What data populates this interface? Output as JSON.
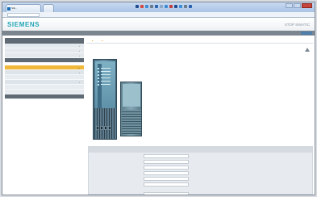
{
  "browser": {
    "tabs": [
      {
        "label": "SIE...",
        "active": true
      },
      {
        "label": ""
      }
    ],
    "address": "",
    "icon_colors": [
      "#1e4c8c",
      "#d6453b",
      "#3b8bd6",
      "#6a7a8a",
      "#2a62b0",
      "#8aa6c4",
      "#3b8bd6",
      "#c23b3b",
      "#1e4c8c",
      "#3b8bd6",
      "#6a7a8a",
      "#2a62b0"
    ]
  },
  "app": {
    "brand": "SIEMENS",
    "title": "STOP SIMATIC",
    "brand_color": "#23a6b8",
    "accent_color": "#f0b93b"
  },
  "statusbar": {
    "left": "",
    "right": ""
  },
  "sidebar": {
    "panel1_title": "",
    "panel1_right": "",
    "items": [
      {
        "label": ""
      },
      {
        "label": ""
      },
      {
        "label": ""
      }
    ],
    "section_item": "",
    "active_item": "",
    "sub_items": [
      {
        "label": ""
      },
      {
        "label": ""
      },
      {
        "label": ""
      },
      {
        "label": ""
      },
      {
        "label": ""
      }
    ],
    "footer_item": ""
  },
  "main": {
    "breadcrumb": [
      "",
      "",
      ""
    ],
    "breadcrumb_right": "",
    "page_title": "",
    "slot_label": "",
    "cpu_leds": 6,
    "io_module_name": "",
    "settings_title": "",
    "fields": [
      {
        "label": "",
        "value": ""
      },
      {
        "label": "",
        "value": ""
      },
      {
        "label": "",
        "value": ""
      },
      {
        "label": "",
        "value": ""
      },
      {
        "label": "",
        "value": ""
      },
      {
        "label": "",
        "value": ""
      }
    ],
    "button_label": "",
    "last_field": {
      "label": "",
      "value": ""
    }
  }
}
